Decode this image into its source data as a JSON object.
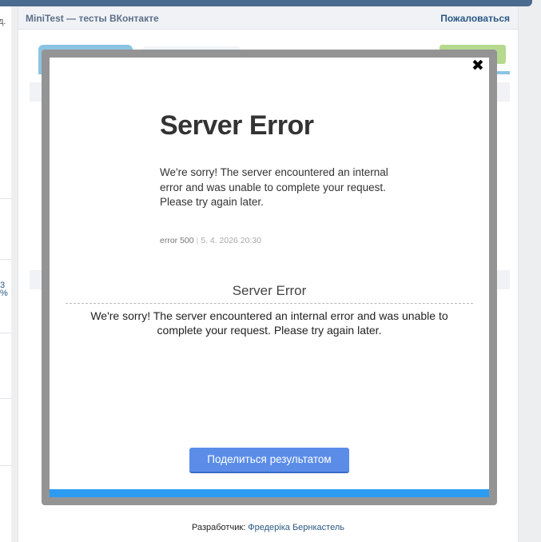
{
  "header": {
    "app_title": "MiniTest — тесты ВКонтакте",
    "report_label": "Пожаловаться"
  },
  "left": {
    "cut_text": "д.",
    "blue_cut": "3\n%"
  },
  "modal": {
    "error_page": {
      "title": "Server Error",
      "message": "We're sorry! The server encountered an internal error and was unable to complete your request. Please try again later.",
      "code": "error 500",
      "separator": "|",
      "date": "5. 4. 2026 20:30"
    },
    "subtitle": "Server Error",
    "submessage": "We're sorry! The server encountered an internal error and was unable to complete your request. Please try again later.",
    "share_label": "Поделиться результатом",
    "close_glyph": "✖"
  },
  "footer": {
    "developer_label": "Разработчик:",
    "developer_name": "Фредеріка Бернкастель"
  },
  "colors": {
    "accent": "#5b8de8",
    "progress_bar": "#2b9cf2",
    "frame": "#949494"
  }
}
